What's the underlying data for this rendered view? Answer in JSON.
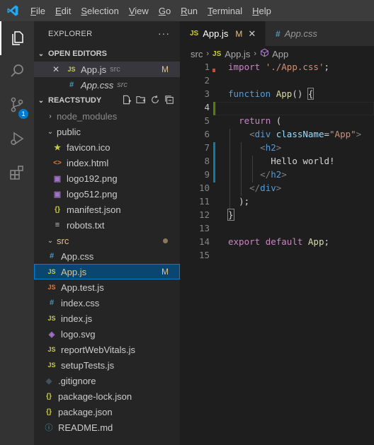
{
  "menu": [
    {
      "u": "F",
      "rest": "ile"
    },
    {
      "u": "E",
      "rest": "dit"
    },
    {
      "u": "S",
      "rest": "election"
    },
    {
      "u": "V",
      "rest": "iew"
    },
    {
      "u": "G",
      "rest": "o"
    },
    {
      "u": "R",
      "rest": "un"
    },
    {
      "u": "T",
      "rest": "erminal"
    },
    {
      "u": "H",
      "rest": "elp"
    }
  ],
  "activity": {
    "source_control_badge": "1"
  },
  "sidebar": {
    "title": "EXPLORER",
    "more": "···",
    "open_editors": {
      "label": "OPEN EDITORS",
      "items": [
        {
          "close": "✕",
          "icon": "JS",
          "name": "App.js",
          "dir": "src",
          "status": "M"
        },
        {
          "icon": "#",
          "name": "App.css",
          "dir": "src"
        }
      ]
    },
    "project": {
      "label": "REACTSTUDY",
      "folders": {
        "node_modules": "node_modules",
        "public": "public",
        "src": "src"
      },
      "public_files": [
        {
          "icon": "★",
          "name": "favicon.ico"
        },
        {
          "icon": "<>",
          "name": "index.html"
        },
        {
          "icon": "▣",
          "name": "logo192.png"
        },
        {
          "icon": "▣",
          "name": "logo512.png"
        },
        {
          "icon": "{}",
          "name": "manifest.json"
        },
        {
          "icon": "≡",
          "name": "robots.txt"
        }
      ],
      "src_files": [
        {
          "icon": "#",
          "name": "App.css"
        },
        {
          "icon": "JS",
          "name": "App.js",
          "status": "M"
        },
        {
          "icon": "JS",
          "name": "App.test.js"
        },
        {
          "icon": "#",
          "name": "index.css"
        },
        {
          "icon": "JS",
          "name": "index.js"
        },
        {
          "icon": "◈",
          "name": "logo.svg"
        },
        {
          "icon": "JS",
          "name": "reportWebVitals.js"
        },
        {
          "icon": "JS",
          "name": "setupTests.js"
        }
      ],
      "root_files": [
        {
          "icon": "◆",
          "name": ".gitignore"
        },
        {
          "icon": "{}",
          "name": "package-lock.json"
        },
        {
          "icon": "{}",
          "name": "package.json"
        },
        {
          "icon": "ⓘ",
          "name": "README.md"
        }
      ]
    }
  },
  "tabs": [
    {
      "icon": "JS",
      "name": "App.js",
      "status": "M",
      "close": "✕"
    },
    {
      "icon": "#",
      "name": "App.css"
    }
  ],
  "breadcrumb": {
    "folder": "src",
    "file": "App.js",
    "symbol": "App"
  },
  "code": {
    "line_numbers": [
      "1",
      "2",
      "3",
      "4",
      "5",
      "6",
      "7",
      "8",
      "9",
      "10",
      "11",
      "12",
      "13",
      "14",
      "15"
    ],
    "l1": {
      "kw": "import",
      "str": "'./App.css'",
      "end": ";"
    },
    "l3": {
      "kw": "function",
      "fn": "App",
      "paren": "()",
      "brace": "{"
    },
    "l5": {
      "kw": "return",
      "paren": "("
    },
    "l6": {
      "open": "<",
      "tag": "div",
      "attr": "className",
      "eq": "=",
      "val": "\"App\"",
      "close": ">"
    },
    "l7": {
      "open": "<",
      "tag": "h2",
      "close": ">"
    },
    "l8": {
      "text": "Hello world!"
    },
    "l9": {
      "open": "</",
      "tag": "h2",
      "close": ">"
    },
    "l10": {
      "open": "</",
      "tag": "div",
      "close": ">"
    },
    "l11": {
      "text": ");"
    },
    "l12": {
      "brace": "}"
    },
    "l14": {
      "kw1": "export",
      "kw2": "default",
      "name": "App",
      "end": ";"
    }
  }
}
